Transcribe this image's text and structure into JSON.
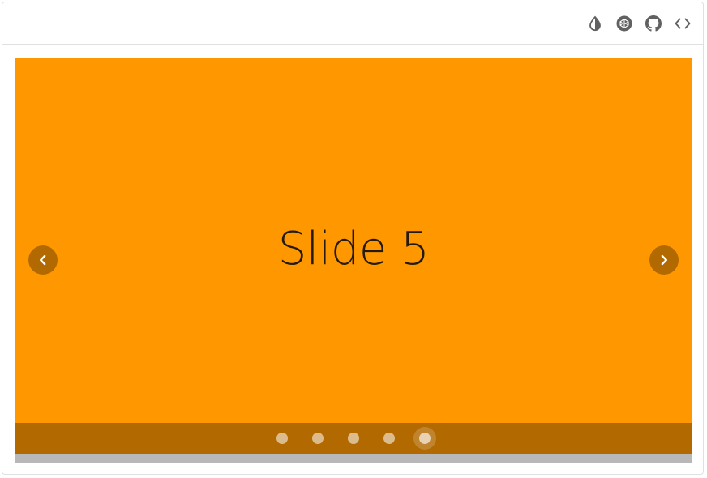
{
  "toolbar": {
    "icons": [
      "theme-toggle-icon",
      "codepen-icon",
      "github-icon",
      "code-icon"
    ],
    "icon_color": "#616161"
  },
  "carousel": {
    "slide_title": "Slide 5",
    "slide_color": "#ff9800",
    "active_slide_index": 4,
    "slide_count": 5,
    "prev_icon": "chevron-left-icon",
    "next_icon": "chevron-right-icon"
  }
}
